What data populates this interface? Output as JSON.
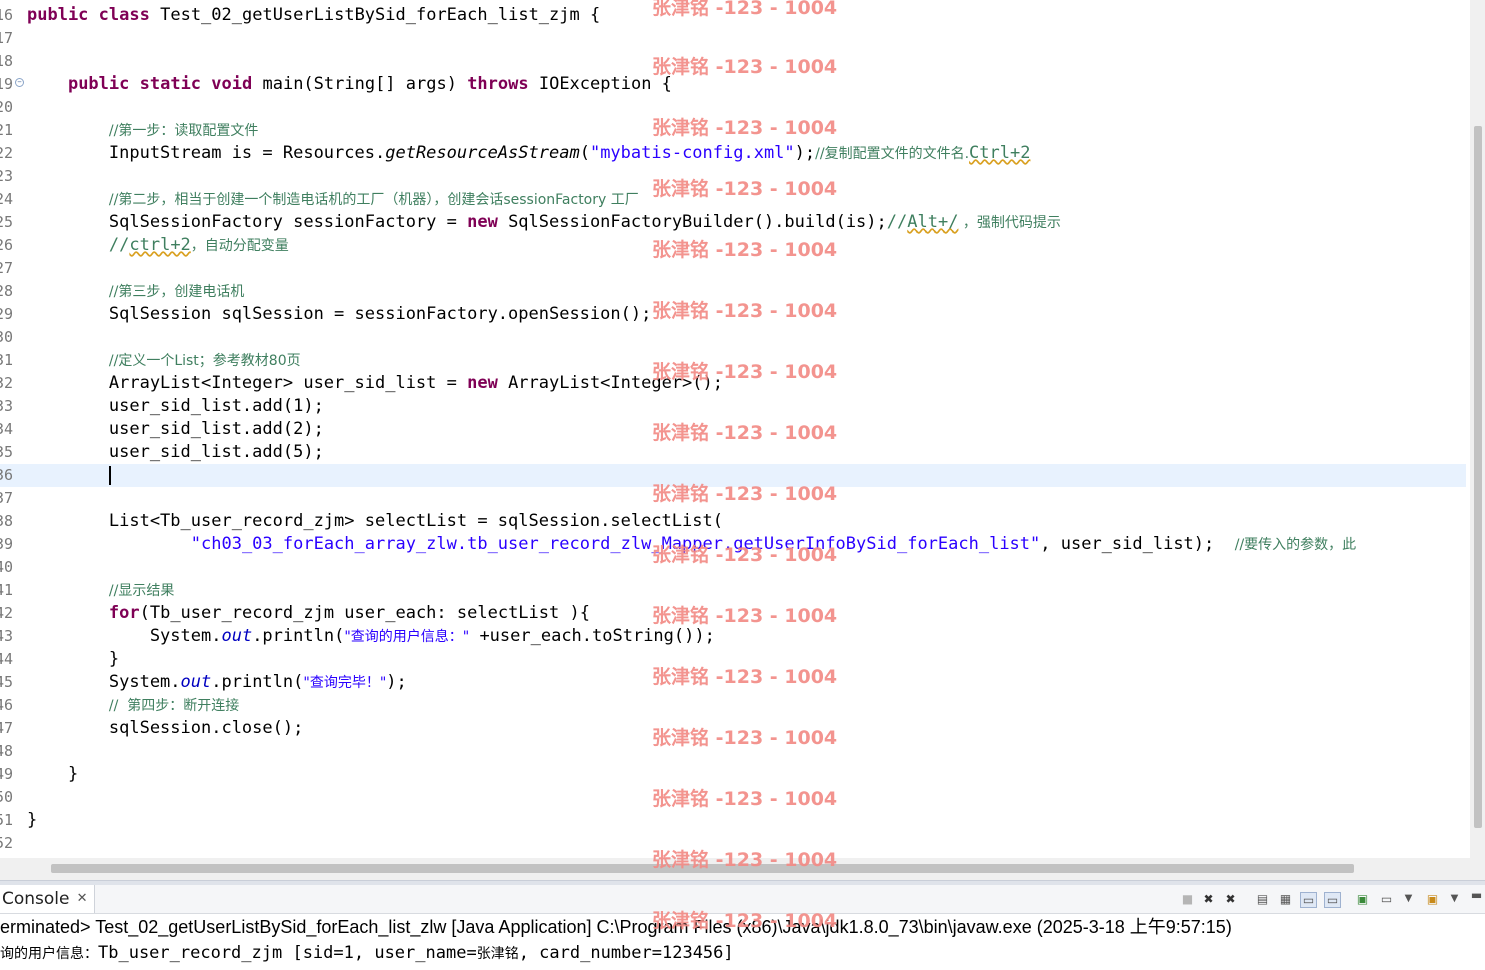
{
  "editor": {
    "line_numbers": [
      "16",
      "17",
      "18",
      "19",
      "20",
      "21",
      "22",
      "23",
      "24",
      "25",
      "26",
      "27",
      "28",
      "29",
      "30",
      "31",
      "32",
      "33",
      "34",
      "35",
      "36",
      "37",
      "38",
      "39",
      "40",
      "41",
      "42",
      "43",
      "44",
      "45",
      "46",
      "47",
      "48",
      "49",
      "50",
      "51",
      "52"
    ],
    "class_name": "Test_02_getUserListBySid_forEach_list_zjm",
    "resource_file": "\"mybatis-config.xml\"",
    "comments": {
      "step1": "//第一步：读取配置文件",
      "copy_name": "//复制配置文件的文件名.",
      "copy_name_key": "Ctrl+2",
      "step2": "//第二步，相当于创建一个制造电话机的工厂（机器），创建会话sessionFactory 工厂",
      "alt_slash_prefix": "//",
      "alt_slash_key": "Alt+/",
      "alt_slash_text": " ，强制代码提示",
      "ctrl2_prefix": "//",
      "ctrl2_key": "ctrl+2",
      "ctrl2_text": "，自动分配变量",
      "step3": "//第三步，创建电话机",
      "define_list": "//定义一个List；参考教材80页",
      "mapper_note": "//要传入的参数，此",
      "show_result": "//显示结果",
      "step4": "//  第四步：断开连接"
    },
    "mapper_id": "\"ch03_03_forEach_array_zlw.tb_user_record_zlw_Mapper.getUserInfoBySid_forEach_list\"",
    "print_user_info": "\"查询的用户信息：\"",
    "print_done": "\"查询完毕！\""
  },
  "watermark": {
    "text": "张津铭 -123 - 1004"
  },
  "console": {
    "tab_label": "Console",
    "status_line": "erminated> Test_02_getUserListBySid_forEach_list_zlw [Java Application] C:\\Program Files (x86)\\Java\\jdk1.8.0_73\\bin\\javaw.exe (2025-3-18 上午9:57:15)",
    "output_prefix": "询的用户信息：",
    "output_line": "Tb_user_record_zjm [sid=1, user_name=",
    "output_name": "张津铭",
    "output_rest": ", card_number=123456]"
  },
  "icons": [
    "close-icon",
    "terminate-icon",
    "remove-launch-icon",
    "remove-all-icon",
    "clear-console-icon",
    "scroll-lock-icon",
    "word-wrap-icon",
    "show-on-output-icon",
    "show-on-error-icon",
    "pin-console-icon",
    "display-console-icon",
    "open-console-icon",
    "view-menu-icon",
    "minimize-icon"
  ]
}
